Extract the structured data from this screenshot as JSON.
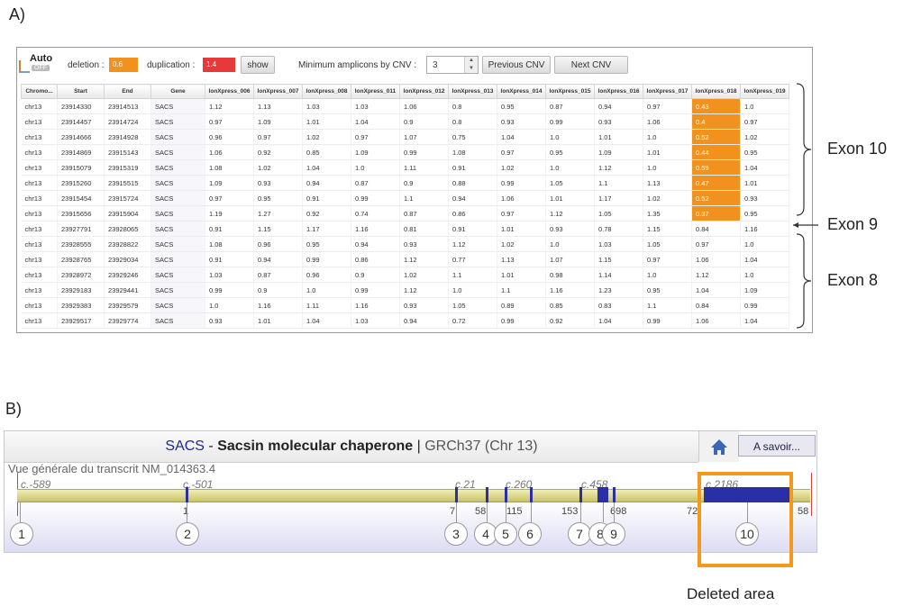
{
  "labels": {
    "panel_a": "A)",
    "panel_b": "B)"
  },
  "toolbar": {
    "auto_label": "Auto",
    "auto_state": "OFF",
    "deletion_label": "deletion :",
    "deletion_value": "0.6",
    "duplication_label": "duplication :",
    "duplication_value": "1.4",
    "show_button": "show",
    "min_amplicons_label": "Minimum amplicons by CNV :",
    "min_amplicons_value": "3",
    "prev_button": "Previous CNV",
    "next_button": "Next CNV"
  },
  "table": {
    "headers": [
      "Chromo...",
      "Start",
      "End",
      "Gene",
      "IonXpress_006",
      "IonXpress_007",
      "IonXpress_008",
      "IonXpress_011",
      "IonXpress_012",
      "IonXpress_013",
      "IonXpress_014",
      "IonXpress_015",
      "IonXpress_016",
      "IonXpress_017",
      "IonXpress_018",
      "IonXpress_019"
    ],
    "rows": [
      [
        "chr13",
        "23914330",
        "23914513",
        "SACS",
        "1.12",
        "1.13",
        "1.03",
        "1.03",
        "1.06",
        "0.8",
        "0.95",
        "0.87",
        "0.94",
        "0.97",
        "0.43",
        "1.0"
      ],
      [
        "chr13",
        "23914457",
        "23914724",
        "SACS",
        "0.97",
        "1.09",
        "1.01",
        "1.04",
        "0.9",
        "0.8",
        "0.93",
        "0.99",
        "0.93",
        "1.06",
        "0.4",
        "0.97"
      ],
      [
        "chr13",
        "23914666",
        "23914928",
        "SACS",
        "0.96",
        "0.97",
        "1.02",
        "0.97",
        "1.07",
        "0.75",
        "1.04",
        "1.0",
        "1.01",
        "1.0",
        "0.52",
        "1.02"
      ],
      [
        "chr13",
        "23914869",
        "23915143",
        "SACS",
        "1.06",
        "0.92",
        "0.85",
        "1.09",
        "0.99",
        "1.08",
        "0.97",
        "0.95",
        "1.09",
        "1.01",
        "0.44",
        "0.95"
      ],
      [
        "chr13",
        "23915079",
        "23915319",
        "SACS",
        "1.08",
        "1.02",
        "1.04",
        "1.0",
        "1.11",
        "0.91",
        "1.02",
        "1.0",
        "1.12",
        "1.0",
        "0.59",
        "1.04"
      ],
      [
        "chr13",
        "23915260",
        "23915515",
        "SACS",
        "1.09",
        "0.93",
        "0.94",
        "0.87",
        "0.9",
        "0.88",
        "0.99",
        "1.05",
        "1.1",
        "1.13",
        "0.47",
        "1.01"
      ],
      [
        "chr13",
        "23915454",
        "23915724",
        "SACS",
        "0.97",
        "0.95",
        "0.91",
        "0.99",
        "1.1",
        "0.94",
        "1.06",
        "1.01",
        "1.17",
        "1.02",
        "0.52",
        "0.93"
      ],
      [
        "chr13",
        "23915656",
        "23915904",
        "SACS",
        "1.19",
        "1.27",
        "0.92",
        "0.74",
        "0.87",
        "0.86",
        "0.97",
        "1.12",
        "1.05",
        "1.35",
        "0.37",
        "0.95"
      ],
      [
        "chr13",
        "23927791",
        "23928065",
        "SACS",
        "0.91",
        "1.15",
        "1.17",
        "1.16",
        "0.81",
        "0.91",
        "1.01",
        "0.93",
        "0.78",
        "1.15",
        "0.84",
        "1.16"
      ],
      [
        "chr13",
        "23928555",
        "23928822",
        "SACS",
        "1.08",
        "0.96",
        "0.95",
        "0.94",
        "0.93",
        "1.12",
        "1.02",
        "1.0",
        "1.03",
        "1.05",
        "0.97",
        "1.0"
      ],
      [
        "chr13",
        "23928765",
        "23929034",
        "SACS",
        "0.91",
        "0.94",
        "0.99",
        "0.86",
        "1.12",
        "0.77",
        "1.13",
        "1.07",
        "1.15",
        "0.97",
        "1.06",
        "1.04"
      ],
      [
        "chr13",
        "23928972",
        "23929246",
        "SACS",
        "1.03",
        "0.87",
        "0.96",
        "0.9",
        "1.02",
        "1.1",
        "1.01",
        "0.98",
        "1.14",
        "1.0",
        "1.12",
        "1.0"
      ],
      [
        "chr13",
        "23929183",
        "23929441",
        "SACS",
        "0.99",
        "0.9",
        "1.0",
        "0.99",
        "1.12",
        "1.0",
        "1.1",
        "1.16",
        "1.23",
        "0.95",
        "1.04",
        "1.09"
      ],
      [
        "chr13",
        "23929383",
        "23929579",
        "SACS",
        "1.0",
        "1.16",
        "1.11",
        "1.16",
        "0.93",
        "1.05",
        "0.89",
        "0.85",
        "0.83",
        "1.1",
        "0.84",
        "0.99"
      ],
      [
        "chr13",
        "23929517",
        "23929774",
        "SACS",
        "0.93",
        "1.01",
        "1.04",
        "1.03",
        "0.94",
        "0.72",
        "0.99",
        "0.92",
        "1.04",
        "0.99",
        "1.06",
        "1.04"
      ]
    ],
    "highlight_color": "#f0921d"
  },
  "annotations": {
    "exon10": "Exon 10",
    "exon9": "Exon 9",
    "exon8": "Exon 8"
  },
  "gene": {
    "symbol": "SACS",
    "sep": " - ",
    "name": "Sacsin molecular chaperone",
    "pipe": " | ",
    "assembly": "GRCh37 (Chr 13)",
    "home_icon": "home-icon",
    "asavoir": "A savoir...",
    "track_title": "Vue générale du transcrit NM_014363.4",
    "cpos": [
      "c.-589",
      "c.-501",
      "c.21",
      "c.260",
      "c.458",
      "c.2186"
    ],
    "axis": [
      "1",
      "7",
      "58",
      "115",
      "153",
      "698",
      "72",
      "58"
    ],
    "exons": [
      "1",
      "2",
      "3",
      "4",
      "5",
      "6",
      "7",
      "8",
      "9",
      "10"
    ]
  },
  "deleted_label": "Deleted area",
  "colors": {
    "exon": "#2a2fa8",
    "deleted_box": "#f39a1e",
    "deletion": "#f0921d",
    "duplication": "#e8393a"
  }
}
